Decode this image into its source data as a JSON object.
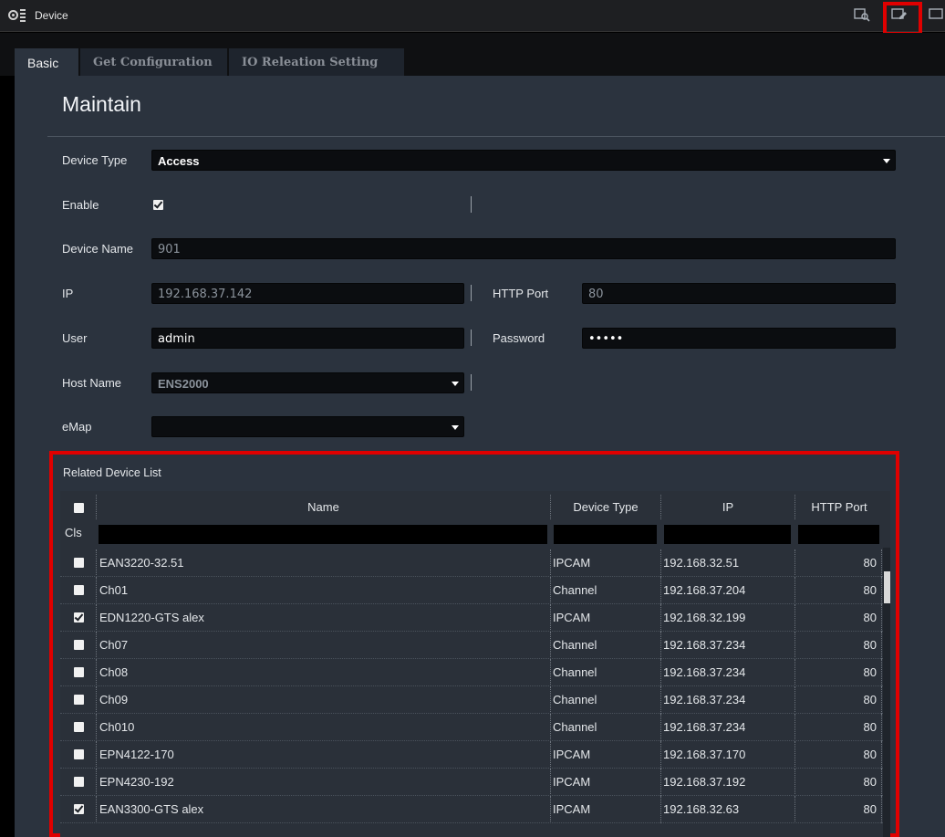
{
  "window": {
    "title": "Device"
  },
  "colors": {
    "highlight": "#e00000",
    "panel": "#2b333e",
    "field": "#0b0d10"
  },
  "icons": [
    "app-logo-icon",
    "search-window-icon",
    "edit-window-icon"
  ],
  "tabs": [
    {
      "label": "Basic",
      "active": true
    },
    {
      "label": "Get Configuration",
      "active": false
    },
    {
      "label": "IO Releation Setting",
      "active": false
    }
  ],
  "section_title": "Maintain",
  "form": {
    "device_type": {
      "label": "Device Type",
      "value": "Access"
    },
    "enable": {
      "label": "Enable",
      "checked": true
    },
    "device_name": {
      "label": "Device Name",
      "value": "901"
    },
    "ip": {
      "label": "IP",
      "value": "192.168.37.142"
    },
    "http_port": {
      "label": "HTTP Port",
      "value": "80"
    },
    "user": {
      "label": "User",
      "value": "admin"
    },
    "password": {
      "label": "Password",
      "value": "•••••"
    },
    "host_name": {
      "label": "Host Name",
      "value": "ENS2000"
    },
    "emap": {
      "label": "eMap",
      "value": ""
    }
  },
  "related_list": {
    "title": "Related Device List",
    "columns": {
      "name": "Name",
      "device_type": "Device Type",
      "ip": "IP",
      "http_port": "HTTP Port"
    },
    "filter_label": "Cls",
    "rows": [
      {
        "checked": false,
        "name": "EAN3220-32.51",
        "type": "IPCAM",
        "ip": "192.168.32.51",
        "port": "80"
      },
      {
        "checked": false,
        "name": "Ch01",
        "type": "Channel",
        "ip": "192.168.37.204",
        "port": "80"
      },
      {
        "checked": true,
        "name": "EDN1220-GTS alex",
        "type": "IPCAM",
        "ip": "192.168.32.199",
        "port": "80"
      },
      {
        "checked": false,
        "name": "Ch07",
        "type": "Channel",
        "ip": "192.168.37.234",
        "port": "80"
      },
      {
        "checked": false,
        "name": "Ch08",
        "type": "Channel",
        "ip": "192.168.37.234",
        "port": "80"
      },
      {
        "checked": false,
        "name": "Ch09",
        "type": "Channel",
        "ip": "192.168.37.234",
        "port": "80"
      },
      {
        "checked": false,
        "name": "Ch010",
        "type": "Channel",
        "ip": "192.168.37.234",
        "port": "80"
      },
      {
        "checked": false,
        "name": "EPN4122-170",
        "type": "IPCAM",
        "ip": "192.168.37.170",
        "port": "80"
      },
      {
        "checked": false,
        "name": "EPN4230-192",
        "type": "IPCAM",
        "ip": "192.168.37.192",
        "port": "80"
      },
      {
        "checked": true,
        "name": "EAN3300-GTS alex",
        "type": "IPCAM",
        "ip": "192.168.32.63",
        "port": "80"
      }
    ]
  }
}
